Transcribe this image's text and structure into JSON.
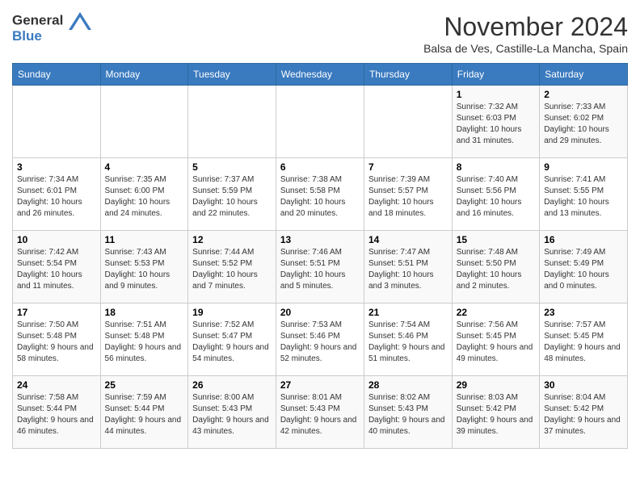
{
  "logo": {
    "line1": "General",
    "line2": "Blue"
  },
  "title": "November 2024",
  "subtitle": "Balsa de Ves, Castille-La Mancha, Spain",
  "days_header": [
    "Sunday",
    "Monday",
    "Tuesday",
    "Wednesday",
    "Thursday",
    "Friday",
    "Saturday"
  ],
  "weeks": [
    [
      {
        "day": "",
        "info": ""
      },
      {
        "day": "",
        "info": ""
      },
      {
        "day": "",
        "info": ""
      },
      {
        "day": "",
        "info": ""
      },
      {
        "day": "",
        "info": ""
      },
      {
        "day": "1",
        "info": "Sunrise: 7:32 AM\nSunset: 6:03 PM\nDaylight: 10 hours and 31 minutes."
      },
      {
        "day": "2",
        "info": "Sunrise: 7:33 AM\nSunset: 6:02 PM\nDaylight: 10 hours and 29 minutes."
      }
    ],
    [
      {
        "day": "3",
        "info": "Sunrise: 7:34 AM\nSunset: 6:01 PM\nDaylight: 10 hours and 26 minutes."
      },
      {
        "day": "4",
        "info": "Sunrise: 7:35 AM\nSunset: 6:00 PM\nDaylight: 10 hours and 24 minutes."
      },
      {
        "day": "5",
        "info": "Sunrise: 7:37 AM\nSunset: 5:59 PM\nDaylight: 10 hours and 22 minutes."
      },
      {
        "day": "6",
        "info": "Sunrise: 7:38 AM\nSunset: 5:58 PM\nDaylight: 10 hours and 20 minutes."
      },
      {
        "day": "7",
        "info": "Sunrise: 7:39 AM\nSunset: 5:57 PM\nDaylight: 10 hours and 18 minutes."
      },
      {
        "day": "8",
        "info": "Sunrise: 7:40 AM\nSunset: 5:56 PM\nDaylight: 10 hours and 16 minutes."
      },
      {
        "day": "9",
        "info": "Sunrise: 7:41 AM\nSunset: 5:55 PM\nDaylight: 10 hours and 13 minutes."
      }
    ],
    [
      {
        "day": "10",
        "info": "Sunrise: 7:42 AM\nSunset: 5:54 PM\nDaylight: 10 hours and 11 minutes."
      },
      {
        "day": "11",
        "info": "Sunrise: 7:43 AM\nSunset: 5:53 PM\nDaylight: 10 hours and 9 minutes."
      },
      {
        "day": "12",
        "info": "Sunrise: 7:44 AM\nSunset: 5:52 PM\nDaylight: 10 hours and 7 minutes."
      },
      {
        "day": "13",
        "info": "Sunrise: 7:46 AM\nSunset: 5:51 PM\nDaylight: 10 hours and 5 minutes."
      },
      {
        "day": "14",
        "info": "Sunrise: 7:47 AM\nSunset: 5:51 PM\nDaylight: 10 hours and 3 minutes."
      },
      {
        "day": "15",
        "info": "Sunrise: 7:48 AM\nSunset: 5:50 PM\nDaylight: 10 hours and 2 minutes."
      },
      {
        "day": "16",
        "info": "Sunrise: 7:49 AM\nSunset: 5:49 PM\nDaylight: 10 hours and 0 minutes."
      }
    ],
    [
      {
        "day": "17",
        "info": "Sunrise: 7:50 AM\nSunset: 5:48 PM\nDaylight: 9 hours and 58 minutes."
      },
      {
        "day": "18",
        "info": "Sunrise: 7:51 AM\nSunset: 5:48 PM\nDaylight: 9 hours and 56 minutes."
      },
      {
        "day": "19",
        "info": "Sunrise: 7:52 AM\nSunset: 5:47 PM\nDaylight: 9 hours and 54 minutes."
      },
      {
        "day": "20",
        "info": "Sunrise: 7:53 AM\nSunset: 5:46 PM\nDaylight: 9 hours and 52 minutes."
      },
      {
        "day": "21",
        "info": "Sunrise: 7:54 AM\nSunset: 5:46 PM\nDaylight: 9 hours and 51 minutes."
      },
      {
        "day": "22",
        "info": "Sunrise: 7:56 AM\nSunset: 5:45 PM\nDaylight: 9 hours and 49 minutes."
      },
      {
        "day": "23",
        "info": "Sunrise: 7:57 AM\nSunset: 5:45 PM\nDaylight: 9 hours and 48 minutes."
      }
    ],
    [
      {
        "day": "24",
        "info": "Sunrise: 7:58 AM\nSunset: 5:44 PM\nDaylight: 9 hours and 46 minutes."
      },
      {
        "day": "25",
        "info": "Sunrise: 7:59 AM\nSunset: 5:44 PM\nDaylight: 9 hours and 44 minutes."
      },
      {
        "day": "26",
        "info": "Sunrise: 8:00 AM\nSunset: 5:43 PM\nDaylight: 9 hours and 43 minutes."
      },
      {
        "day": "27",
        "info": "Sunrise: 8:01 AM\nSunset: 5:43 PM\nDaylight: 9 hours and 42 minutes."
      },
      {
        "day": "28",
        "info": "Sunrise: 8:02 AM\nSunset: 5:43 PM\nDaylight: 9 hours and 40 minutes."
      },
      {
        "day": "29",
        "info": "Sunrise: 8:03 AM\nSunset: 5:42 PM\nDaylight: 9 hours and 39 minutes."
      },
      {
        "day": "30",
        "info": "Sunrise: 8:04 AM\nSunset: 5:42 PM\nDaylight: 9 hours and 37 minutes."
      }
    ]
  ]
}
